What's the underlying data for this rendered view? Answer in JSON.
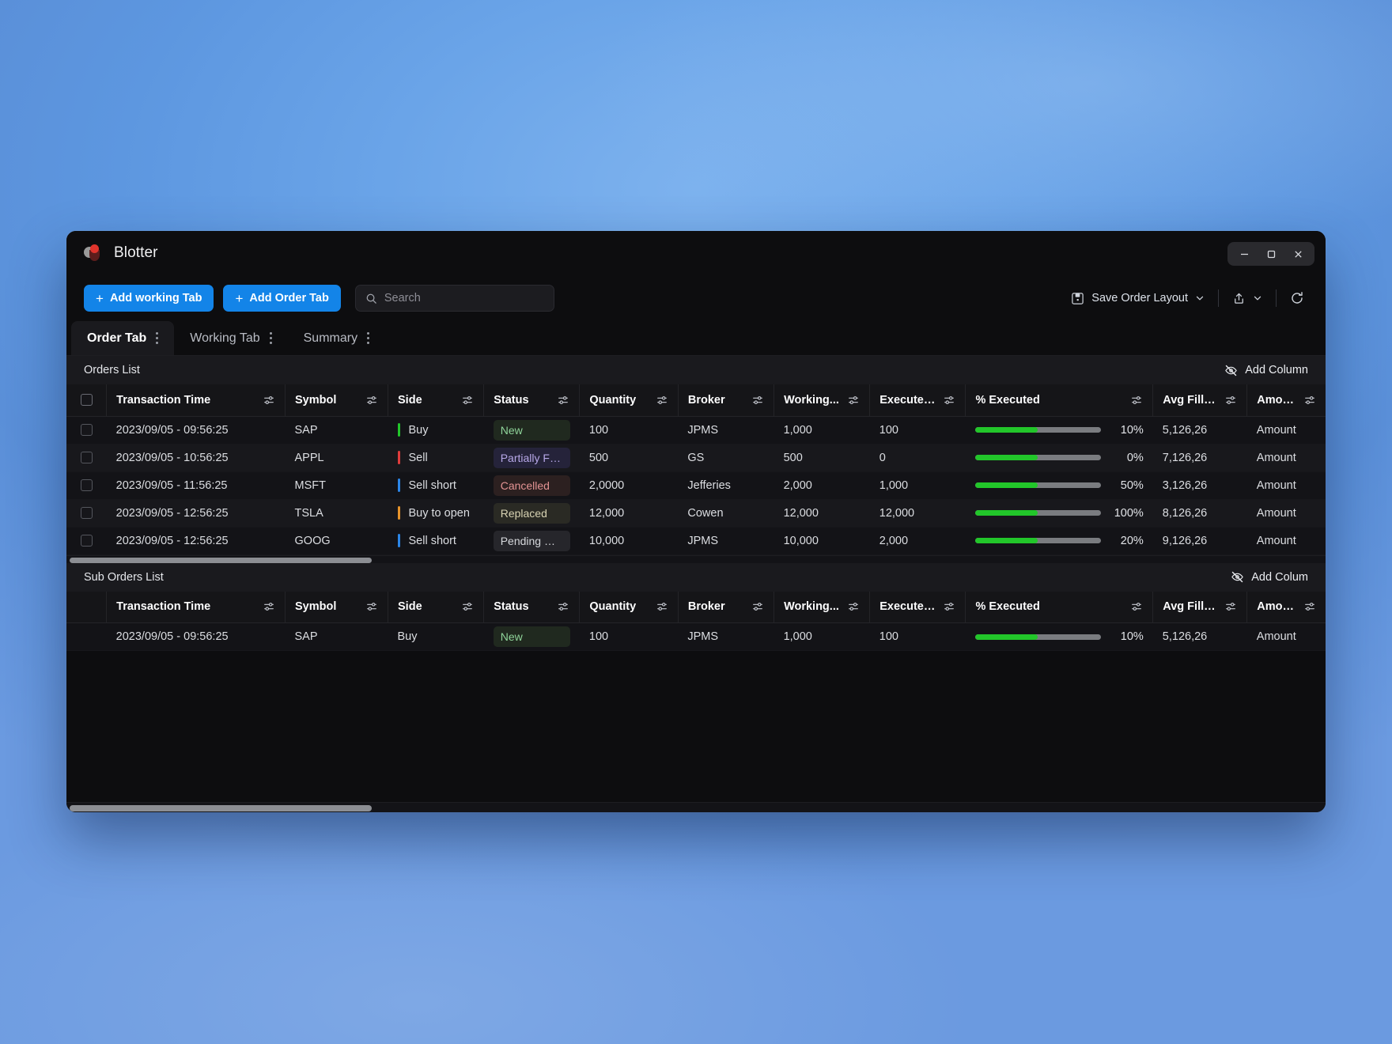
{
  "window": {
    "title": "Blotter",
    "logo_icon": "blotter-logo",
    "controls": [
      {
        "name": "minimize-button",
        "icon": "minimize-icon"
      },
      {
        "name": "maximize-button",
        "icon": "maximize-icon"
      },
      {
        "name": "close-button",
        "icon": "close-icon"
      }
    ]
  },
  "toolbar": {
    "add_working_tab": "Add working Tab",
    "add_order_tab": "Add Order Tab",
    "plus": "+",
    "search": {
      "value": "",
      "placeholder": "Search",
      "icon": "search-icon"
    },
    "save_layout": {
      "label": "Save Order Layout",
      "icon": "save-disk-icon",
      "chevron": "chevron-down-icon"
    },
    "share": {
      "icon": "share-upload-icon",
      "chevron": "chevron-down-icon"
    },
    "refresh": {
      "icon": "refresh-icon"
    }
  },
  "tabs": [
    {
      "label": "Order Tab",
      "active": true,
      "menu_icon": "kebab-menu-icon"
    },
    {
      "label": "Working Tab",
      "active": false,
      "menu_icon": "kebab-menu-icon"
    },
    {
      "label": "Summary",
      "active": false,
      "menu_icon": "kebab-menu-icon"
    }
  ],
  "orders_panel": {
    "title": "Orders List",
    "add_column": {
      "label": "Add Column",
      "icon": "eye-off-icon"
    },
    "columns": [
      "Transaction Time",
      "Symbol",
      "Side",
      "Status",
      "Quantity",
      "Broker",
      "Working...",
      "Executed..",
      "% Executed",
      "Avg Fill P...",
      "Amount"
    ],
    "filter_icon": "filter-sliders-icon",
    "rows": [
      {
        "checked": false,
        "transaction_time": "2023/09/05 - 09:56:25",
        "symbol": "SAP",
        "side": "Buy",
        "side_color": "#22c62a",
        "status": "New",
        "status_color": "#8fd49a",
        "status_bg": "#20291f",
        "quantity": "100",
        "broker": "JPMS",
        "working": "1,000",
        "executed": "100",
        "pct": "10%",
        "pct_fill": 50,
        "avg_fill_price": "5,126,26",
        "amount": "Amount"
      },
      {
        "checked": false,
        "transaction_time": "2023/09/05 - 10:56:25",
        "symbol": "APPL",
        "side": "Sell",
        "side_color": "#e03c3c",
        "status": "Partially Filled",
        "status_color": "#b7a8e8",
        "status_bg": "#25233a",
        "quantity": "500",
        "broker": "GS",
        "working": "500",
        "executed": "0",
        "pct": "0%",
        "pct_fill": 50,
        "avg_fill_price": "7,126,26",
        "amount": "Amount"
      },
      {
        "checked": false,
        "transaction_time": "2023/09/05 - 11:56:25",
        "symbol": "MSFT",
        "side": "Sell short",
        "side_color": "#2b86e8",
        "status": "Cancelled",
        "status_color": "#e39393",
        "status_bg": "#2c2020",
        "quantity": "2,0000",
        "broker": "Jefferies",
        "working": "2,000",
        "executed": "1,000",
        "pct": "50%",
        "pct_fill": 50,
        "avg_fill_price": "3,126,26",
        "amount": "Amount"
      },
      {
        "checked": false,
        "transaction_time": "2023/09/05 - 12:56:25",
        "symbol": "TSLA",
        "side": "Buy to open",
        "side_color": "#e8942b",
        "status": "Replaced",
        "status_color": "#d8d3b3",
        "status_bg": "#2a2a24",
        "quantity": "12,000",
        "broker": "Cowen",
        "working": "12,000",
        "executed": "12,000",
        "pct": "100%",
        "pct_fill": 50,
        "avg_fill_price": "8,126,26",
        "amount": "Amount"
      },
      {
        "checked": false,
        "transaction_time": "2023/09/05 - 12:56:25",
        "symbol": "GOOG",
        "side": "Sell short",
        "side_color": "#2b86e8",
        "status": "Pending Canc...",
        "status_color": "#d6d8dc",
        "status_bg": "#26262b",
        "quantity": "10,000",
        "broker": "JPMS",
        "working": "10,000",
        "executed": "2,000",
        "pct": "20%",
        "pct_fill": 50,
        "avg_fill_price": "9,126,26",
        "amount": "Amount"
      }
    ],
    "hscroll_thumb_pct": 24
  },
  "sub_orders_panel": {
    "title": "Sub Orders List",
    "add_column": {
      "label": "Add Colum",
      "icon": "eye-off-icon"
    },
    "columns": [
      "Transaction Time",
      "Symbol",
      "Side",
      "Status",
      "Quantity",
      "Broker",
      "Working...",
      "Executed..",
      "% Executed",
      "Avg Fill P...",
      "Amount"
    ],
    "filter_icon": "filter-sliders-icon",
    "rows": [
      {
        "checked": false,
        "transaction_time": "2023/09/05 - 09:56:25",
        "symbol": "SAP",
        "side": "Buy",
        "side_color": "",
        "status": "New",
        "status_color": "#8fd49a",
        "status_bg": "#20291f",
        "quantity": "100",
        "broker": "JPMS",
        "working": "1,000",
        "executed": "100",
        "pct": "10%",
        "pct_fill": 50,
        "avg_fill_price": "5,126,26",
        "amount": "Amount"
      }
    ]
  },
  "bottom_scroll_thumb_pct": 24,
  "colors": {
    "accent": "#1384e8",
    "progress": "#22c62a",
    "window_bg": "#0d0d0f",
    "row_odd": "#131317",
    "row_even": "#18181c"
  }
}
